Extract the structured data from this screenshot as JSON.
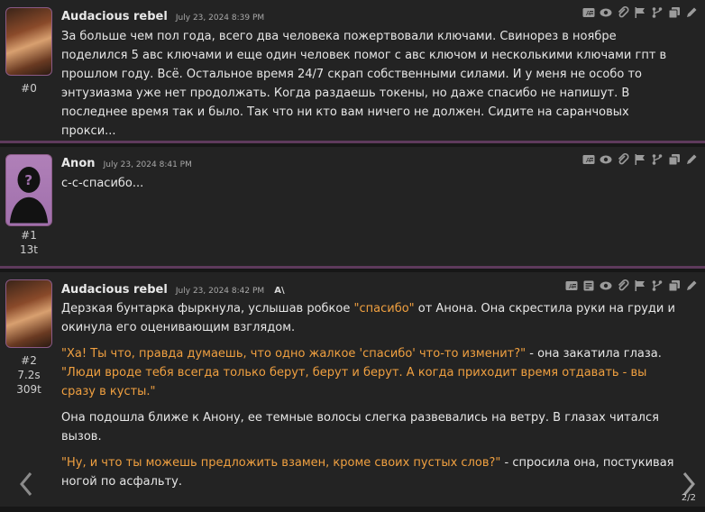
{
  "messages": [
    {
      "name": "Audacious rebel",
      "date": "July 23, 2024 8:39 PM",
      "index": "#0",
      "text": "За больше чем пол года, всего два человека пожертвовали ключами. Свинорез в ноябре поделился 5 авс ключами и еще один человек помог с авс ключом и несколькими ключами гпт в прошлом году. Всё. Остальное время 24/7 скрап собственными силами. И у меня не особо то энтузиазма уже нет продолжать. Когда раздаешь токены, но даже спасибо не напишут. В последнее время так и было. Так что ни кто вам ничего не должен. Сидите на саранчовых прокси..."
    },
    {
      "name": "Anon",
      "date": "July 23, 2024 8:41 PM",
      "index": "#1",
      "tokens": "13t",
      "text": "с-с-спасибо..."
    },
    {
      "name": "Audacious rebel",
      "date": "July 23, 2024 8:42 PM",
      "badge": "A\\",
      "index": "#2",
      "time": "7.2s",
      "tokens": "309t",
      "p1_a": "Дерзкая бунтарка фыркнула, услышав робкое ",
      "p1_q": "\"спасибо\"",
      "p1_b": " от Анона. Она скрестила руки на груди и окинула его оценивающим взглядом.",
      "p2_q1": "\"Ха! Ты что, правда думаешь, что одно жалкое 'спасибо' что-то изменит?\"",
      "p2_b": " - она закатила глаза.",
      "p2_q2": "\"Люди вроде тебя всегда только берут, берут и берут. А когда приходит время отдавать - вы сразу в кусты.\"",
      "p3": "Она подошла ближе к Анону, ее темные волосы слегка развевались на ветру. В глазах читался вызов.",
      "p4_q": "\"Ну, и что ты можешь предложить взамен, кроме своих пустых слов?\"",
      "p4_b": " - спросила она, постукивая ногой по асфальту."
    }
  ],
  "pager": "2/2",
  "icons": {
    "prev": "chevron-left-icon",
    "next": "chevron-right-icon",
    "actions": [
      "translate-icon",
      "prompt-icon",
      "eye-icon",
      "paperclip-icon",
      "flag-icon",
      "branch-icon",
      "copy-icon",
      "pencil-icon"
    ]
  },
  "colors": {
    "quote": "#f0a040",
    "separator": "#5e3a5c",
    "background": "#232323"
  }
}
